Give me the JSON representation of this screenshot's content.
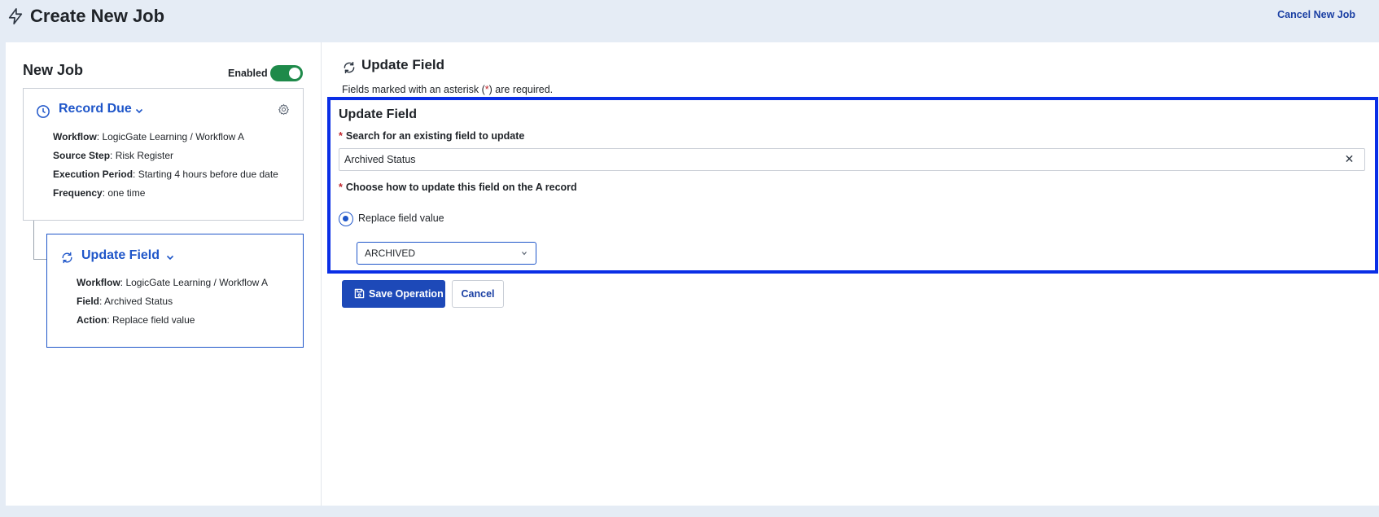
{
  "header": {
    "icon": "bolt-icon",
    "title": "Create New Job",
    "cancel_link": "Cancel New Job"
  },
  "left": {
    "heading": "New Job",
    "enabled_label": "Enabled",
    "enabled": true,
    "trigger_card": {
      "icon": "clock-icon",
      "title": "Record Due",
      "details": [
        {
          "label": "Workflow",
          "value": "LogicGate Learning  / Workflow A"
        },
        {
          "label": "Source Step",
          "value": "Risk Register"
        },
        {
          "label": "Execution Period",
          "value": "Starting 4 hours before due date"
        },
        {
          "label": "Frequency",
          "value": "one time"
        }
      ]
    },
    "operation_card": {
      "icon": "refresh-icon",
      "title": "Update Field",
      "details": [
        {
          "label": "Workflow",
          "value": "LogicGate Learning  / Workflow A"
        },
        {
          "label": "Field",
          "value": "Archived Status"
        },
        {
          "label": "Action",
          "value": "Replace field value"
        }
      ]
    }
  },
  "right": {
    "title": "Update Field",
    "note_prefix": "Fields marked with an asterisk (",
    "note_asterisk": "*",
    "note_suffix": ") are required.",
    "form": {
      "title": "Update Field",
      "required_mark": "*",
      "search_label": "Search for an existing field to update",
      "search_value": "Archived Status",
      "method_label": "Choose how to update this field on the A record",
      "radio_label": "Replace field value",
      "select_value": "ARCHIVED"
    },
    "buttons": {
      "save": "Save Operation",
      "cancel": "Cancel"
    }
  },
  "colors": {
    "accent": "#1f56c9",
    "focus_border": "#0a2ee6",
    "toggle_on": "#1e8a4a",
    "required": "#c0262d"
  }
}
